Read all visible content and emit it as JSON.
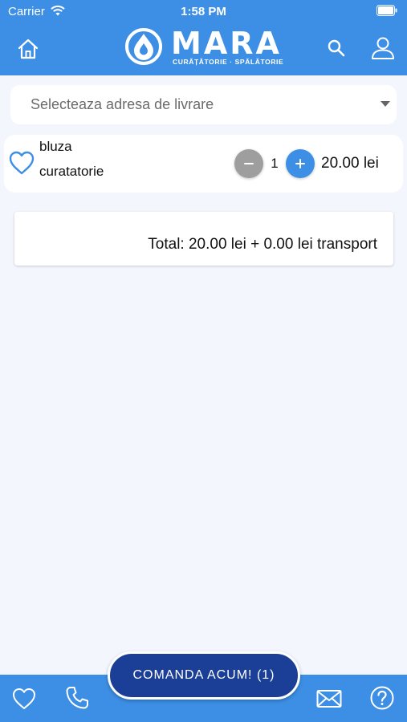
{
  "status_bar": {
    "carrier": "Carrier",
    "time": "1:58 PM"
  },
  "header": {
    "logo_title": "MARA",
    "logo_subtitle": "CURĂȚĂTORIE · SPĂLĂTORIE",
    "icons": [
      "home-icon",
      "search-icon",
      "profile-icon"
    ],
    "color": "#3d8fe6"
  },
  "address": {
    "placeholder": "Selecteaza adresa de livrare"
  },
  "cart": {
    "items": [
      {
        "name": "bluza",
        "category": "curatatorie",
        "quantity": "1",
        "price": "20.00 lei"
      }
    ]
  },
  "total": {
    "text": "Total: 20.00 lei + 0.00 lei transport"
  },
  "order_button": {
    "label": "COMANDA ACUM! (1)",
    "color": "#1b3f96"
  },
  "bottom_nav": {
    "icons": [
      "heart-icon",
      "phone-icon",
      "mail-icon",
      "help-icon"
    ]
  }
}
